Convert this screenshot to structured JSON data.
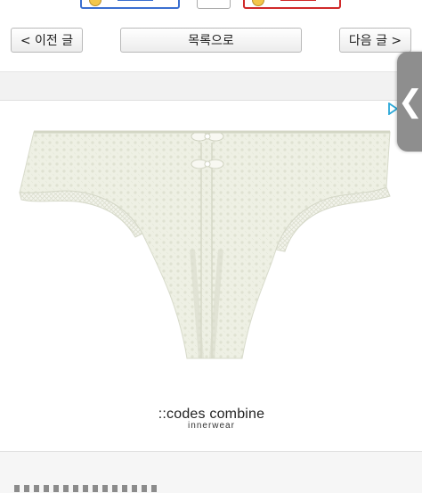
{
  "nav": {
    "prev_label": "< 이전 글",
    "list_label": "목록으로",
    "next_label": "다음 글 >"
  },
  "side_panel": {
    "toggle_glyph": "❮"
  },
  "product": {
    "brand_name": "::codes combine",
    "brand_sub": "innerwear"
  },
  "colors": {
    "lace": "#eef0e4",
    "toolbar_blue": "#3b6fd0",
    "toolbar_red": "#d02a2a",
    "handle": "#8e8e8e"
  }
}
